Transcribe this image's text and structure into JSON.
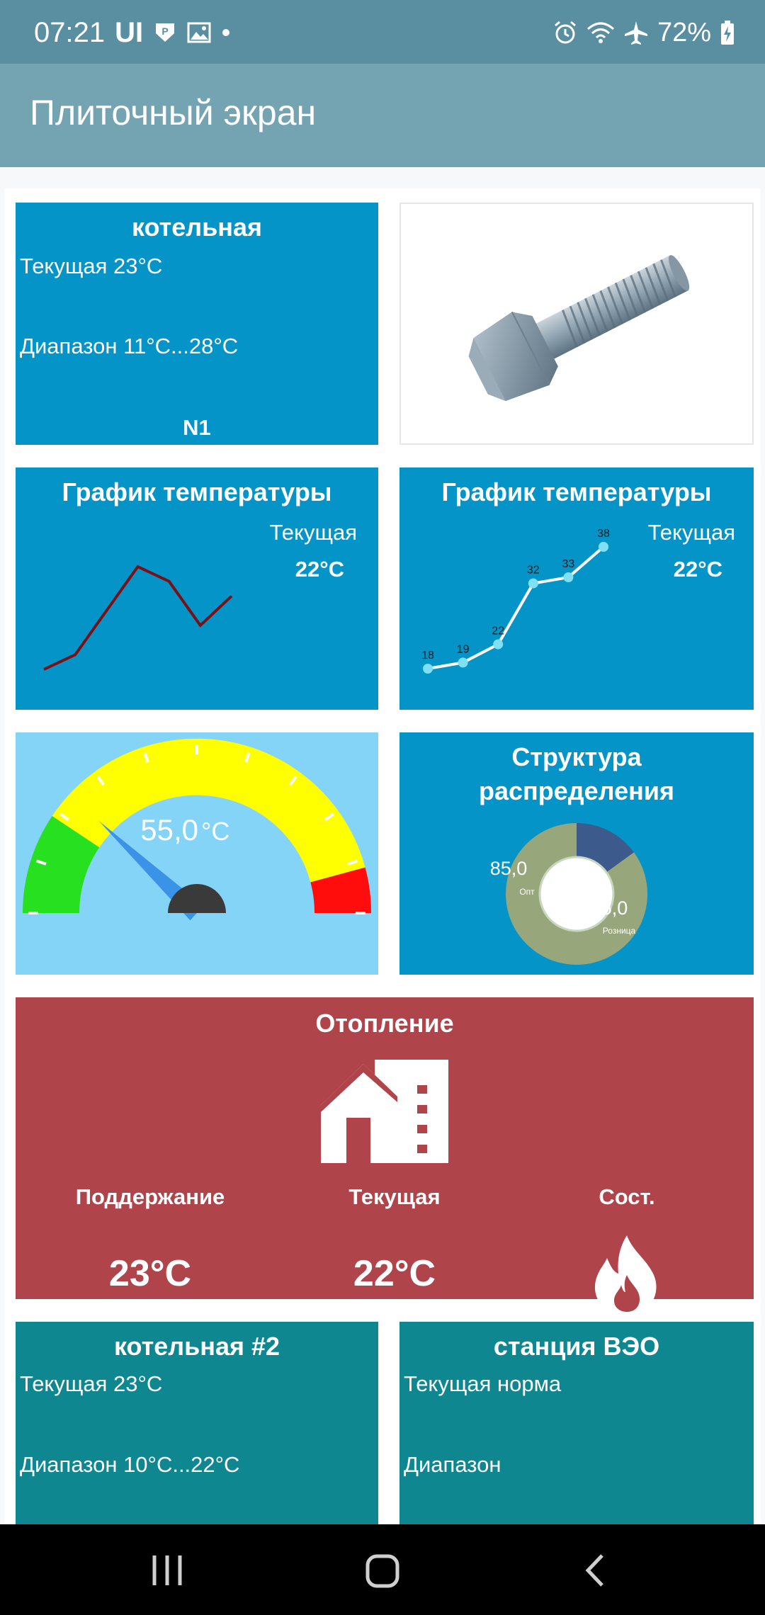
{
  "status_bar": {
    "time": "07:21",
    "carrier": "UI",
    "battery": "72%",
    "icons": [
      "vpn-icon",
      "gallery-icon",
      "dot-icon",
      "alarm-icon",
      "wifi-icon",
      "airplane-icon",
      "battery-charging-icon"
    ]
  },
  "app_bar": {
    "title": "Плиточный экран"
  },
  "tiles": {
    "boiler1": {
      "title": "котельная",
      "current": "Текущая 23°C",
      "range": "Диапазон 11°C...28°C",
      "footer": "N1"
    },
    "image_tile": {
      "image": "bolt-image"
    },
    "chart1": {
      "title": "График температуры",
      "current_label": "Текущая",
      "current_value": "22°C"
    },
    "chart2": {
      "title": "График температуры",
      "current_label": "Текущая",
      "current_value": "22°C"
    },
    "gauge": {
      "value": "55,0",
      "unit": "°C"
    },
    "donut": {
      "title_line1": "Структура",
      "title_line2": "распределения",
      "big_value": "85,0",
      "big_label": "Опт",
      "small_value": "15,0",
      "small_label": "Розница"
    },
    "heating": {
      "title": "Отопление",
      "col1_label": "Поддержание",
      "col1_value": "23°C",
      "col2_label": "Текущая",
      "col2_value": "22°C",
      "col3_label": "Сост."
    },
    "boiler2": {
      "title": "котельная #2",
      "current": "Текущая 23°C",
      "range": "Диапазон 10°C...22°C"
    },
    "station": {
      "title": "станция ВЭО",
      "current": "Текущая норма",
      "range": "Диапазон"
    }
  },
  "chart_data": [
    {
      "type": "line",
      "x": [
        1,
        2,
        3,
        4,
        5,
        6,
        7
      ],
      "series": [
        {
          "values": [
            18,
            19,
            22,
            25,
            24,
            21,
            23
          ]
        }
      ],
      "color": "#7a1016"
    },
    {
      "type": "line",
      "x": [
        1,
        2,
        3,
        4,
        5,
        6
      ],
      "series": [
        {
          "values": [
            18,
            19,
            22,
            32,
            33,
            38
          ]
        }
      ],
      "data_labels": [
        "18",
        "19",
        "22",
        "32",
        "33",
        "38"
      ],
      "color": "#ffffff"
    },
    {
      "type": "pie",
      "categories": [
        "Опт",
        "Розница"
      ],
      "values": [
        85.0,
        15.0
      ],
      "colors": [
        "#98a67c",
        "#3d5a8c"
      ]
    }
  ],
  "gauge_data": {
    "value": 55.0,
    "min": 0,
    "max": 100,
    "green_max": 18,
    "yellow_max": 88
  },
  "navigation": {
    "recent": "recent-apps-button",
    "home": "home-button",
    "back": "back-button"
  }
}
